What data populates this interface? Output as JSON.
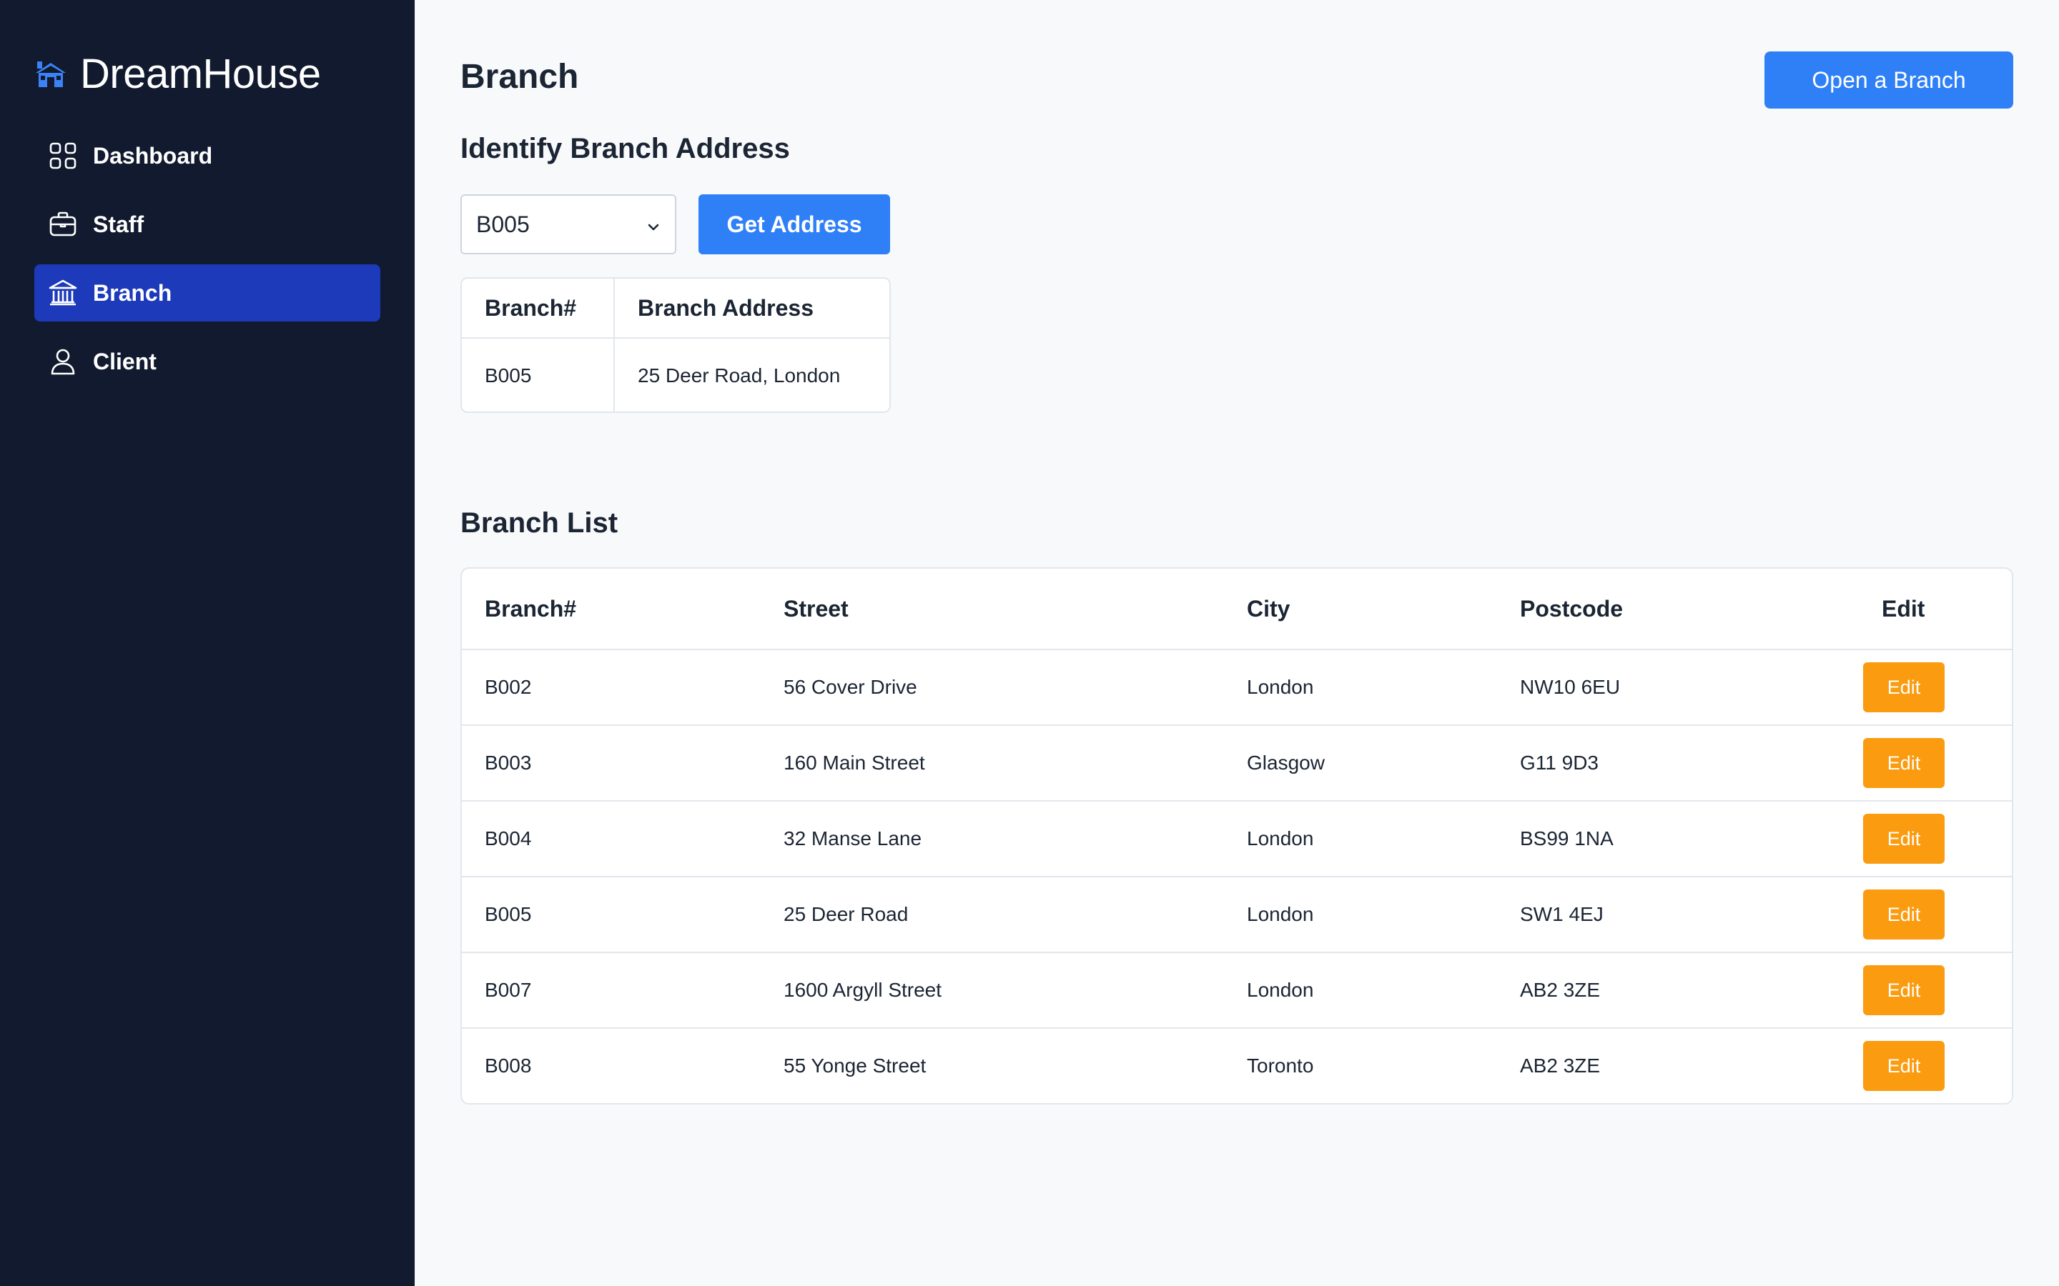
{
  "brand": {
    "name": "DreamHouse",
    "icon": "house-icon"
  },
  "colors": {
    "sidebar_bg": "#111a2e",
    "active_nav": "#1c3ab9",
    "primary": "#2f80f7",
    "edit": "#fb9b0f",
    "brand_icon": "#3b82f6"
  },
  "nav": {
    "items": [
      {
        "label": "Dashboard",
        "icon": "grid-icon",
        "active": false
      },
      {
        "label": "Staff",
        "icon": "briefcase-icon",
        "active": false
      },
      {
        "label": "Branch",
        "icon": "bank-icon",
        "active": true
      },
      {
        "label": "Client",
        "icon": "user-icon",
        "active": false
      }
    ]
  },
  "page": {
    "title": "Branch",
    "open_branch_label": "Open a Branch"
  },
  "identify": {
    "title": "Identify Branch Address",
    "selected_branch": "B005",
    "get_address_label": "Get Address",
    "table": {
      "headers": [
        "Branch#",
        "Branch Address"
      ],
      "row": [
        "B005",
        "25 Deer Road, London"
      ]
    }
  },
  "branch_list": {
    "title": "Branch List",
    "headers": [
      "Branch#",
      "Street",
      "City",
      "Postcode",
      "Edit"
    ],
    "edit_label": "Edit",
    "rows": [
      [
        "B002",
        "56 Cover Drive",
        "London",
        "NW10 6EU"
      ],
      [
        "B003",
        "160 Main Street",
        "Glasgow",
        "G11 9D3"
      ],
      [
        "B004",
        "32 Manse Lane",
        "London",
        "BS99 1NA"
      ],
      [
        "B005",
        "25 Deer Road",
        "London",
        "SW1 4EJ"
      ],
      [
        "B007",
        "1600 Argyll Street",
        "London",
        "AB2 3ZE"
      ],
      [
        "B008",
        "55 Yonge Street",
        "Toronto",
        "AB2 3ZE"
      ]
    ]
  }
}
